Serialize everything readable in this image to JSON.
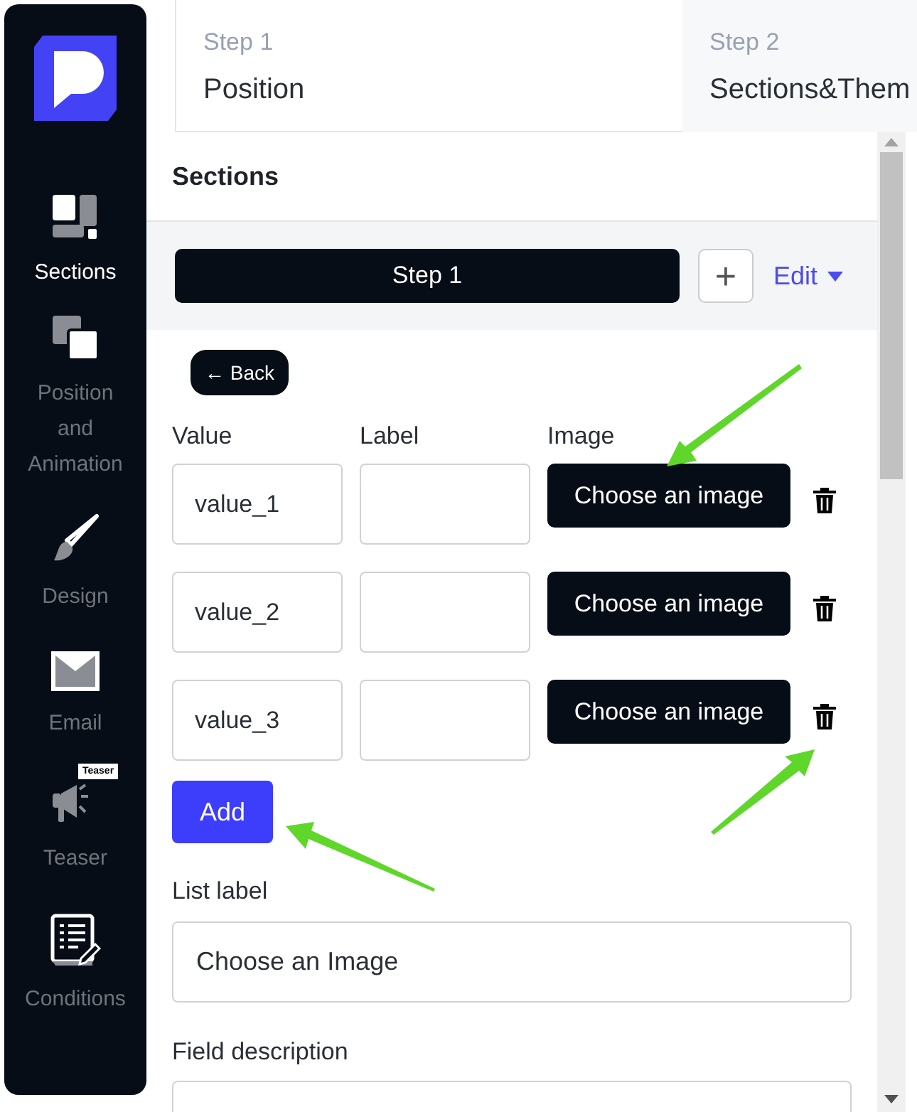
{
  "sidebar": {
    "items": [
      {
        "label": "Sections",
        "selected": true
      },
      {
        "label": "Position and Animation",
        "selected": false
      },
      {
        "label": "Design",
        "selected": false
      },
      {
        "label": "Email",
        "selected": false
      },
      {
        "label": "Teaser",
        "selected": false,
        "badge": "Teaser"
      },
      {
        "label": "Conditions",
        "selected": false
      }
    ]
  },
  "tabs": [
    {
      "step": "Step 1",
      "title": "Position",
      "selected": true
    },
    {
      "step": "Step 2",
      "title": "Sections&Them",
      "selected": false
    }
  ],
  "panel": {
    "title": "Sections",
    "section_button": "Step 1",
    "add_section": "+",
    "edit": "Edit",
    "back": "← Back",
    "columns": [
      "Value",
      "Label",
      "Image"
    ],
    "rows": [
      {
        "value": "value_1",
        "image_button": "Choose an image"
      },
      {
        "value": "value_2",
        "image_button": "Choose an image"
      },
      {
        "value": "value_3",
        "image_button": "Choose an image"
      }
    ],
    "add_button": "Add",
    "list_label": {
      "label": "List label",
      "value": "Choose an Image"
    },
    "field_description": {
      "label": "Field description"
    }
  }
}
